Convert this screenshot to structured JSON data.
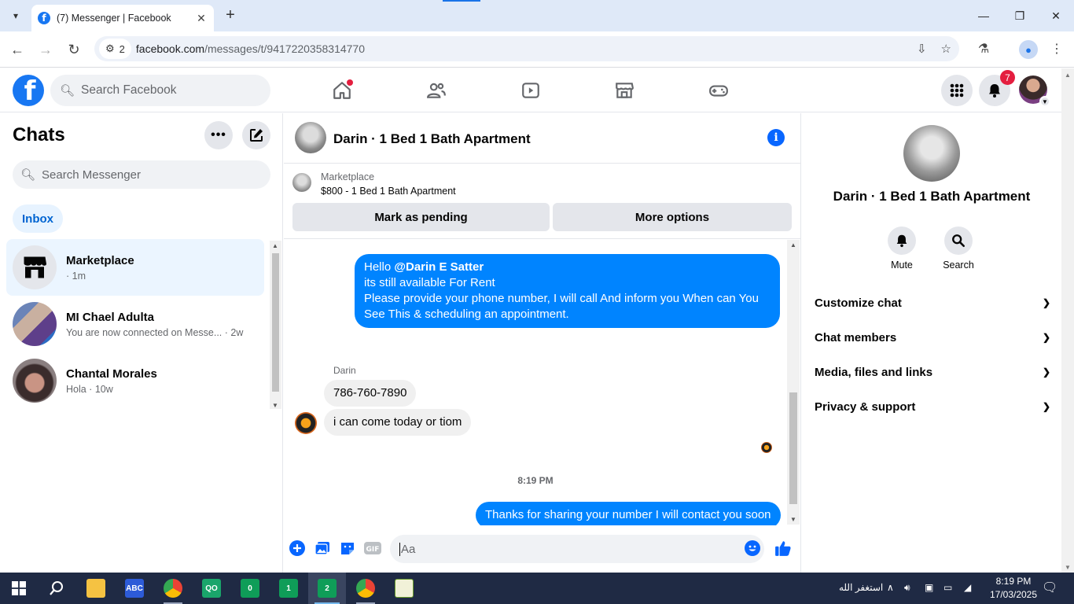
{
  "browser": {
    "tab_title": "(7) Messenger | Facebook",
    "tab_close": "✕",
    "new_tab": "+",
    "site_badge_count": "2",
    "url_host": "facebook.com",
    "url_path": "/messages/t/9417220358314770"
  },
  "fb_header": {
    "search_placeholder": "Search Facebook",
    "notification_count": "7"
  },
  "sidebar": {
    "title": "Chats",
    "search_placeholder": "Search Messenger",
    "inbox_label": "Inbox",
    "chats": [
      {
        "name": "Marketplace",
        "sub": "· 1m"
      },
      {
        "name": "MI Chael Adulta",
        "sub": "You are now connected on Messe... · 2w"
      },
      {
        "name": "Chantal Morales",
        "sub": "Hola · 10w"
      }
    ]
  },
  "conversation": {
    "title": "Darin · 1 Bed 1 Bath Apartment",
    "marketplace_label": "Marketplace",
    "listing": "$800 - 1 Bed 1 Bath Apartment",
    "mark_pending": "Mark as pending",
    "more_options": "More options",
    "outgoing_1": {
      "line1_prefix": "Hello ",
      "line1_mention": "@Darin E Satter",
      "line2": "its still available For Rent",
      "line3": "Please provide your phone number, I will call And inform you When can You",
      "line4": "See This & scheduling an appointment."
    },
    "sender_name": "Darin",
    "incoming_1": "786-760-7890",
    "incoming_2": "i can come today or tiom",
    "timestamp": "8:19 PM",
    "outgoing_2": "Thanks for sharing your number I will contact you soon",
    "composer_placeholder": "Aa"
  },
  "info_panel": {
    "name": "Darin · 1 Bed 1 Bath Apartment",
    "actions": [
      {
        "label": "Mute",
        "icon": "bell-icon"
      },
      {
        "label": "Search",
        "icon": "search-icon"
      }
    ],
    "sections": [
      "Customize chat",
      "Chat members",
      "Media, files and links",
      "Privacy & support"
    ]
  },
  "taskbar": {
    "tray_text": "استغفر الله",
    "time": "8:19 PM",
    "date": "17/03/2025",
    "apps": [
      {
        "label": "",
        "icon": "folder-icon"
      },
      {
        "label": "",
        "icon": "abc-icon"
      },
      {
        "label": "",
        "icon": "chrome-icon"
      },
      {
        "label": "",
        "icon": "qo-icon"
      },
      {
        "label": "0",
        "icon": "green-app-icon"
      },
      {
        "label": "1",
        "icon": "green-app-icon"
      },
      {
        "label": "2",
        "icon": "green-app-icon"
      },
      {
        "label": "",
        "icon": "chrome-icon"
      },
      {
        "label": "",
        "icon": "chart-app-icon"
      }
    ]
  },
  "colors": {
    "fb_blue": "#1877f2",
    "messenger_out": "#0084ff",
    "taskbar": "#1f2a44"
  }
}
